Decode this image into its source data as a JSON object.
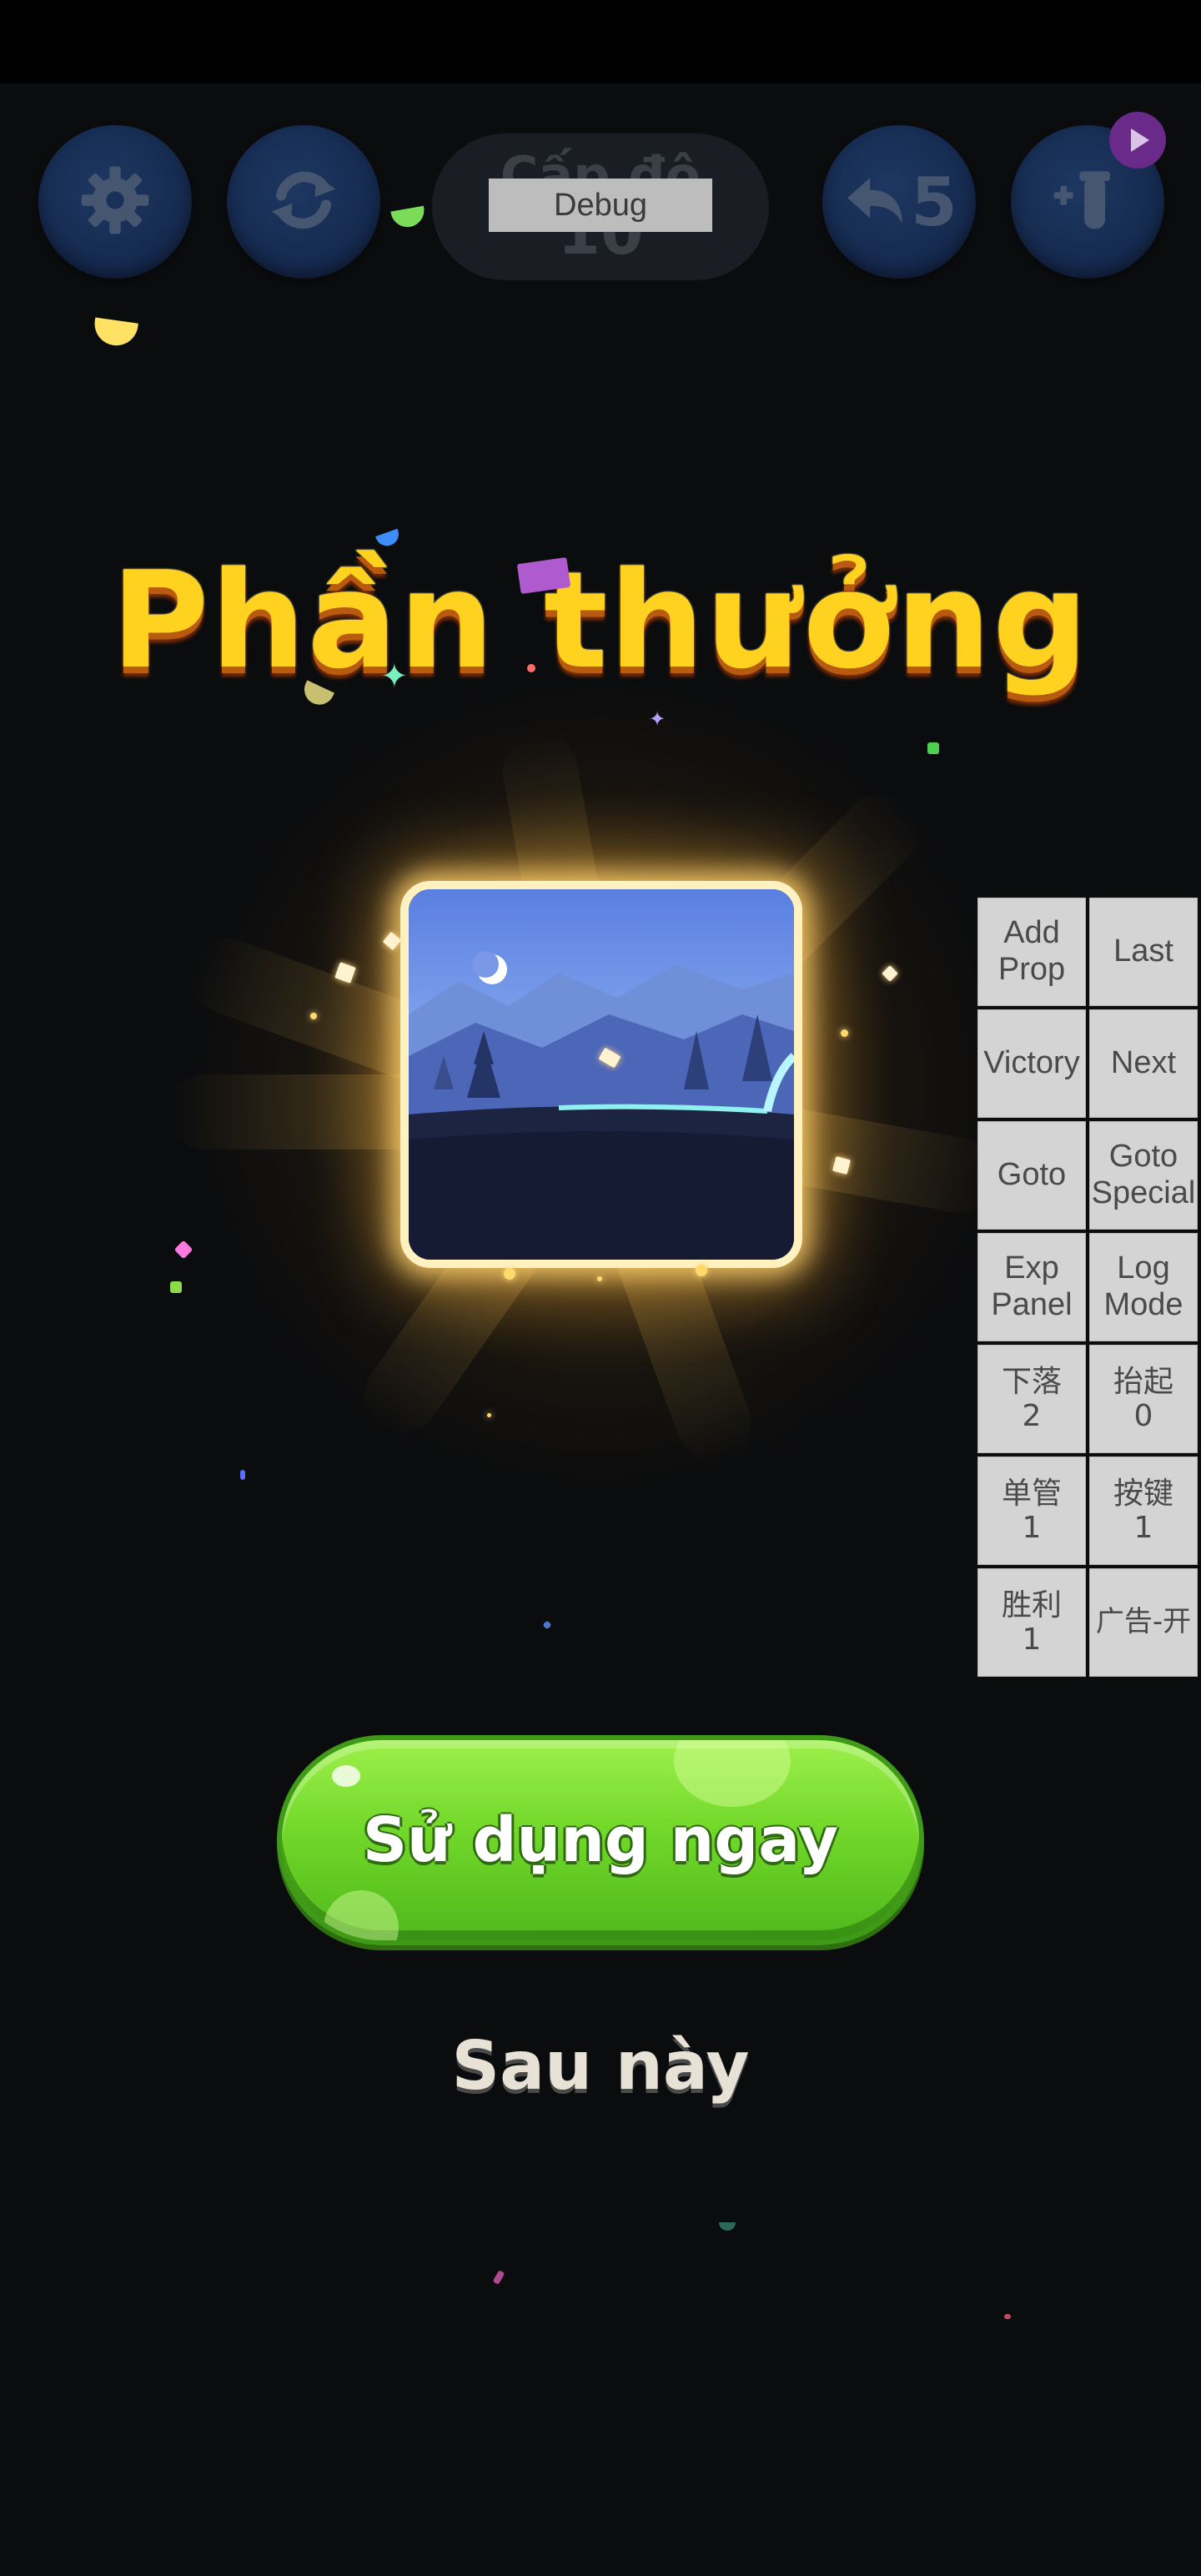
{
  "hud": {
    "settings_icon": "gear-icon",
    "restart_icon": "refresh-icon",
    "level_label": "Cấp độ",
    "level_number": "10",
    "debug_label": "Debug",
    "undo_icon": "undo-arrow-icon",
    "undo_count": "5",
    "add_tube_icon": "add-tube-icon",
    "ad_badge_icon": "play-video-icon"
  },
  "reward": {
    "title": "Phần thưởng",
    "item_icon": "night-landscape-background-icon"
  },
  "debug_panel": {
    "buttons": [
      {
        "label": "Add\nProp"
      },
      {
        "label": "Last"
      },
      {
        "label": "Victory"
      },
      {
        "label": "Next"
      },
      {
        "label": "Goto"
      },
      {
        "label": "Goto\nSpecial"
      },
      {
        "label": "Exp\nPanel"
      },
      {
        "label": "Log\nMode"
      },
      {
        "label": "下落\n2"
      },
      {
        "label": "抬起\n0"
      },
      {
        "label": "单管\n1"
      },
      {
        "label": "按键\n1"
      },
      {
        "label": "胜利\n1"
      },
      {
        "label": "广告-开"
      }
    ]
  },
  "actions": {
    "use_now_label": "Sử dụng ngay",
    "later_label": "Sau này"
  },
  "colors": {
    "title_gold": "#ffd21f",
    "button_green": "#72d82a",
    "hud_blue": "#1a3566"
  }
}
